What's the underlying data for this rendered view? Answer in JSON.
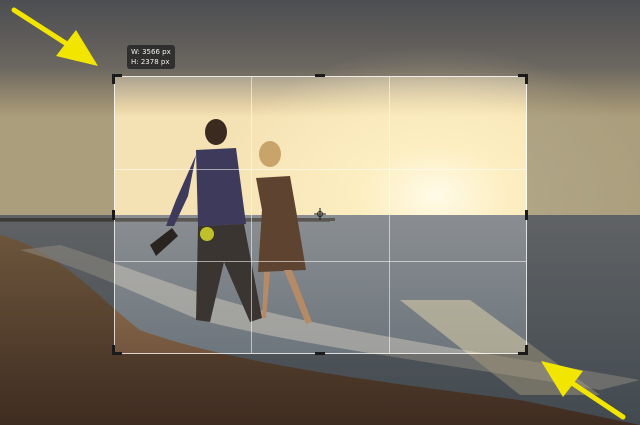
{
  "canvas": {
    "subject": "Couple walking barefoot along the beach at sunset",
    "colors": {
      "sky_top": "#6f7277",
      "sun": "#fff4cc",
      "sand": "#8a6a4c",
      "water": "#7a8690"
    }
  },
  "crop": {
    "width_text": "W: 3566 px",
    "height_text": "H: 2378 px",
    "grid": "rule-of-thirds"
  },
  "annotations": {
    "arrow_color": "#f2e600",
    "arrows": [
      "top-left",
      "bottom-right"
    ]
  },
  "icons": [
    "crop-handle-icon",
    "pivot-point-icon",
    "arrow-icon"
  ]
}
